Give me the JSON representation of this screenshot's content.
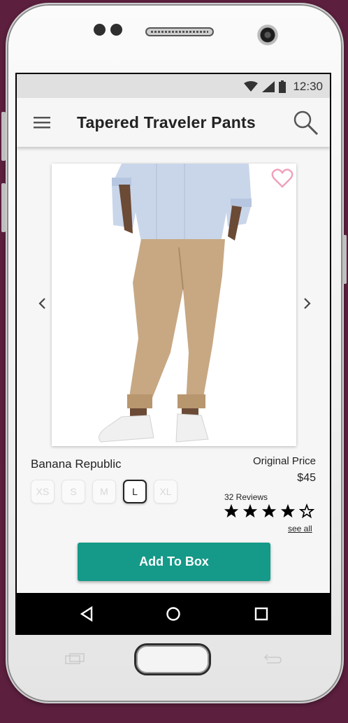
{
  "status_bar": {
    "time": "12:30"
  },
  "app_bar": {
    "title": "Tapered Traveler Pants",
    "menu_icon": "hamburger-menu-icon",
    "search_icon": "search-icon"
  },
  "product": {
    "brand": "Banana Republic",
    "original_price_label": "Original Price",
    "price": "$45",
    "favorite_icon": "heart-outline-icon",
    "sizes": [
      "XS",
      "S",
      "M",
      "L",
      "XL"
    ],
    "selected_size": "L",
    "reviews_label": "32 Reviews",
    "rating": 4,
    "rating_max": 5,
    "see_all": "see all"
  },
  "actions": {
    "add_to_box": "Add To Box"
  },
  "colors": {
    "accent": "#159988",
    "heart": "#f0a0b8",
    "background": "#5c1f3e"
  }
}
